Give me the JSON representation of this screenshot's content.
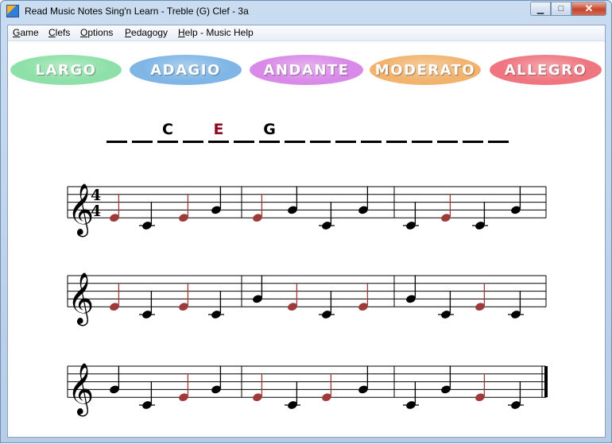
{
  "window": {
    "title": "Read Music Notes Sing'n Learn - Treble (G) Clef - 3a",
    "minimize": "▁",
    "maximize": "□",
    "close": "✕",
    "icon": "app-icon"
  },
  "menu": [
    "Game",
    "Clefs",
    "Options",
    "Pedagogy",
    "Help - Music Help"
  ],
  "tempos": [
    {
      "label": "LARGO",
      "color": "#8ee0a8"
    },
    {
      "label": "ADAGIO",
      "color": "#7fb6e6"
    },
    {
      "label": "ANDANTE",
      "color": "#d98ae8"
    },
    {
      "label": "MODERATO",
      "color": "#f1b36e"
    },
    {
      "label": "ALLEGRO",
      "color": "#ef7680"
    }
  ],
  "answer": [
    "",
    "",
    "C",
    "",
    "E",
    "",
    "G",
    "",
    "",
    "",
    "",
    "",
    "",
    "",
    "",
    ""
  ],
  "answer_highlight_index": 4,
  "time_signature": {
    "top": "4",
    "bottom": "4"
  },
  "colors": {
    "note_black": "#000000",
    "note_red": "#9e3a3a",
    "answer_red": "#8a0b22"
  },
  "staves": [
    [
      [
        {
          "pitch": "E4",
          "color": "red"
        },
        {
          "pitch": "C4",
          "color": "black"
        },
        {
          "pitch": "E4",
          "color": "red"
        },
        {
          "pitch": "G4",
          "color": "black"
        }
      ],
      [
        {
          "pitch": "E4",
          "color": "red"
        },
        {
          "pitch": "G4",
          "color": "black"
        },
        {
          "pitch": "C4",
          "color": "black"
        },
        {
          "pitch": "G4",
          "color": "black"
        }
      ],
      [
        {
          "pitch": "C4",
          "color": "black"
        },
        {
          "pitch": "E4",
          "color": "red"
        },
        {
          "pitch": "C4",
          "color": "black"
        },
        {
          "pitch": "G4",
          "color": "black"
        }
      ]
    ],
    [
      [
        {
          "pitch": "E4",
          "color": "red"
        },
        {
          "pitch": "C4",
          "color": "black"
        },
        {
          "pitch": "E4",
          "color": "red"
        },
        {
          "pitch": "C4",
          "color": "black"
        }
      ],
      [
        {
          "pitch": "G4",
          "color": "black"
        },
        {
          "pitch": "E4",
          "color": "red"
        },
        {
          "pitch": "C4",
          "color": "black"
        },
        {
          "pitch": "E4",
          "color": "red"
        }
      ],
      [
        {
          "pitch": "G4",
          "color": "black"
        },
        {
          "pitch": "C4",
          "color": "black"
        },
        {
          "pitch": "E4",
          "color": "red"
        },
        {
          "pitch": "C4",
          "color": "black"
        }
      ]
    ],
    [
      [
        {
          "pitch": "G4",
          "color": "black"
        },
        {
          "pitch": "C4",
          "color": "black"
        },
        {
          "pitch": "E4",
          "color": "red"
        },
        {
          "pitch": "G4",
          "color": "black"
        }
      ],
      [
        {
          "pitch": "E4",
          "color": "red"
        },
        {
          "pitch": "C4",
          "color": "black"
        },
        {
          "pitch": "E4",
          "color": "red"
        },
        {
          "pitch": "G4",
          "color": "black"
        }
      ],
      [
        {
          "pitch": "C4",
          "color": "black"
        },
        {
          "pitch": "G4",
          "color": "black"
        },
        {
          "pitch": "E4",
          "color": "red"
        },
        {
          "pitch": "C4",
          "color": "black"
        }
      ]
    ]
  ]
}
